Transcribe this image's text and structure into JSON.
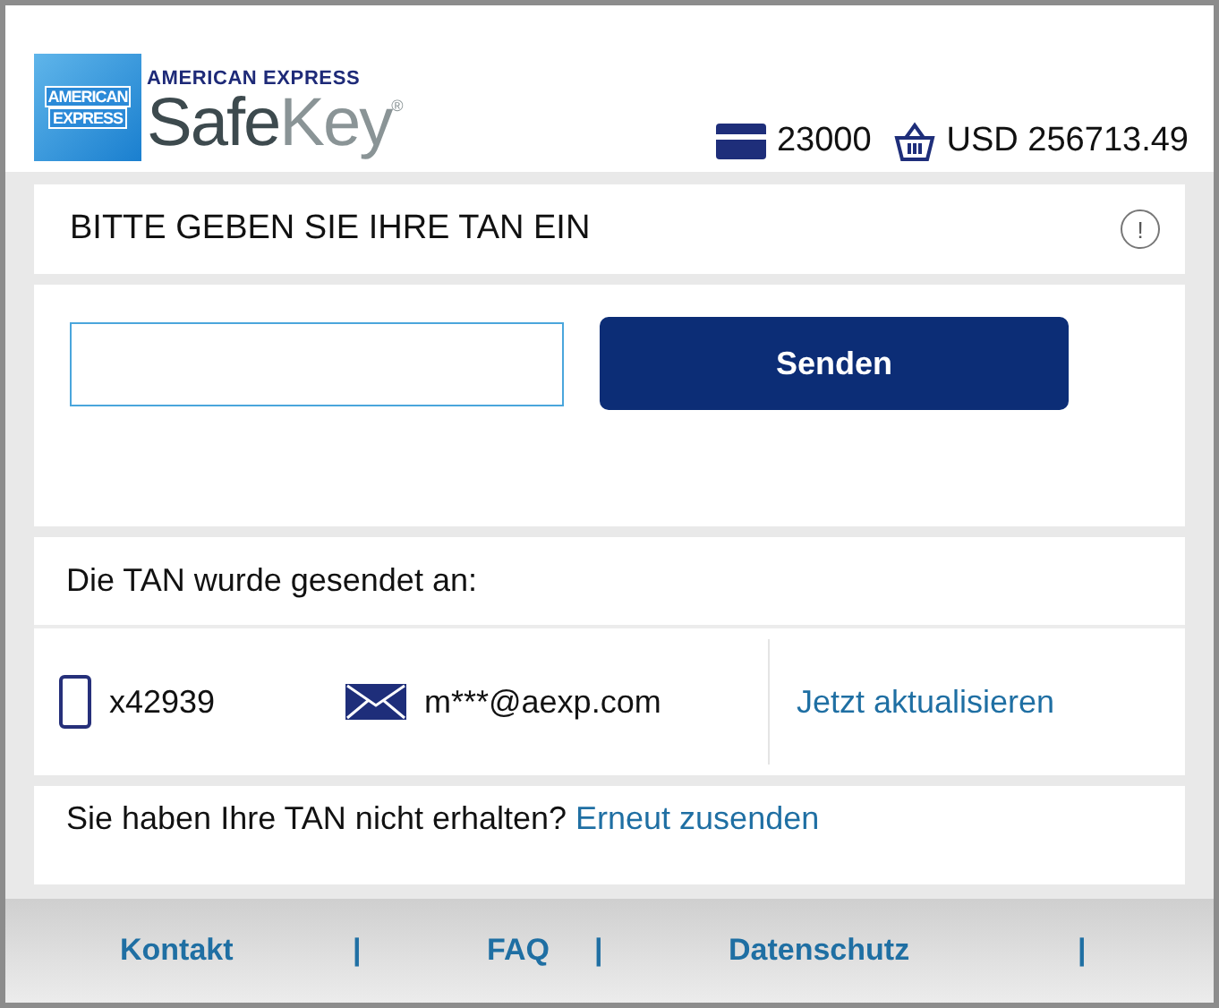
{
  "header": {
    "logo_box": [
      "AMERICAN",
      "EXPRESS"
    ],
    "brand_top": "AMERICAN EXPRESS",
    "brand_main": "Safe",
    "brand_light": "Key",
    "brand_mark": "®",
    "card_number": "23000",
    "amount": "USD 256713.49"
  },
  "prompt": {
    "title": "BITTE GEBEN SIE IHRE TAN EIN",
    "info_glyph": "!"
  },
  "tan_form": {
    "button": "Senden"
  },
  "sent_to": {
    "heading": "Die TAN wurde gesendet an:",
    "phone": "x42939",
    "email": "m***@aexp.com",
    "update_link": "Jetzt aktualisieren"
  },
  "resend": {
    "text": "Sie haben Ihre TAN nicht erhalten?",
    "link": "Erneut zusenden"
  },
  "footer": [
    {
      "label": "Kontakt",
      "separator": "|"
    },
    {
      "label": "FAQ",
      "separator": "|"
    },
    {
      "label": "Datenschutz",
      "separator": "|"
    }
  ]
}
